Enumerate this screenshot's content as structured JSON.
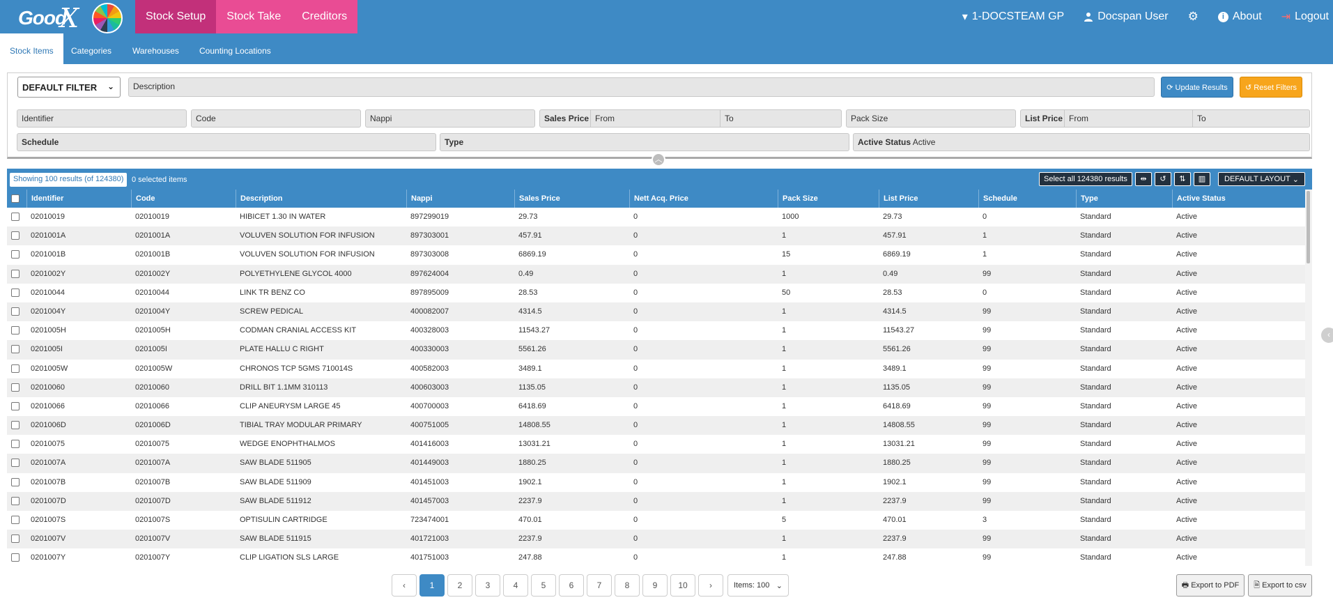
{
  "brand": {
    "logo_text": "Good",
    "logo_x": "X"
  },
  "main_nav": [
    {
      "label": "Stock Setup",
      "active": true
    },
    {
      "label": "Stock Take",
      "active": false
    },
    {
      "label": "Creditors",
      "active": false
    }
  ],
  "right_nav": {
    "practice": "1-DOCSTEAM GP",
    "user": "Docspan User",
    "about": "About",
    "logout": "Logout"
  },
  "sub_tabs": [
    {
      "label": "Stock Items",
      "active": true
    },
    {
      "label": "Categories",
      "active": false
    },
    {
      "label": "Warehouses",
      "active": false
    },
    {
      "label": "Counting Locations",
      "active": false
    }
  ],
  "filters": {
    "filter_select": "DEFAULT FILTER",
    "description_label": "Description",
    "identifier_label": "Identifier",
    "code_label": "Code",
    "nappi_label": "Nappi",
    "sales_price_label": "Sales Price",
    "sales_from": "From",
    "sales_to": "To",
    "pack_size_label": "Pack Size",
    "list_price_label": "List Price",
    "list_from": "From",
    "list_to": "To",
    "schedule_label": "Schedule",
    "type_label": "Type",
    "active_status_label": "Active Status",
    "active_status_value": "Active",
    "update_button": "Update Results",
    "reset_button": "Reset Filters"
  },
  "grid_toolbar": {
    "showing": "Showing 100 results (of 124380)",
    "selected": "0 selected items",
    "select_all": "Select all 124380 results",
    "layout": "DEFAULT LAYOUT"
  },
  "columns": [
    "Identifier",
    "Code",
    "Description",
    "Nappi",
    "Sales Price",
    "Nett Acq. Price",
    "Pack Size",
    "List Price",
    "Schedule",
    "Type",
    "Active Status"
  ],
  "rows": [
    [
      "02010019",
      "02010019",
      "HIBICET 1.30 IN WATER",
      "897299019",
      "29.73",
      "0",
      "1000",
      "29.73",
      "0",
      "Standard",
      "Active"
    ],
    [
      "0201001A",
      "0201001A",
      "VOLUVEN SOLUTION FOR INFUSION",
      "897303001",
      "457.91",
      "0",
      "1",
      "457.91",
      "1",
      "Standard",
      "Active"
    ],
    [
      "0201001B",
      "0201001B",
      "VOLUVEN SOLUTION FOR INFUSION",
      "897303008",
      "6869.19",
      "0",
      "15",
      "6869.19",
      "1",
      "Standard",
      "Active"
    ],
    [
      "0201002Y",
      "0201002Y",
      "POLYETHYLENE GLYCOL 4000",
      "897624004",
      "0.49",
      "0",
      "1",
      "0.49",
      "99",
      "Standard",
      "Active"
    ],
    [
      "02010044",
      "02010044",
      "LINK TR BENZ CO",
      "897895009",
      "28.53",
      "0",
      "50",
      "28.53",
      "0",
      "Standard",
      "Active"
    ],
    [
      "0201004Y",
      "0201004Y",
      "SCREW PEDICAL",
      "400082007",
      "4314.5",
      "0",
      "1",
      "4314.5",
      "99",
      "Standard",
      "Active"
    ],
    [
      "0201005H",
      "0201005H",
      "CODMAN CRANIAL ACCESS KIT",
      "400328003",
      "11543.27",
      "0",
      "1",
      "11543.27",
      "99",
      "Standard",
      "Active"
    ],
    [
      "0201005I",
      "0201005I",
      "PLATE HALLU C RIGHT",
      "400330003",
      "5561.26",
      "0",
      "1",
      "5561.26",
      "99",
      "Standard",
      "Active"
    ],
    [
      "0201005W",
      "0201005W",
      "CHRONOS TCP 5GMS 710014S",
      "400582003",
      "3489.1",
      "0",
      "1",
      "3489.1",
      "99",
      "Standard",
      "Active"
    ],
    [
      "02010060",
      "02010060",
      "DRILL BIT 1.1MM 310113",
      "400603003",
      "1135.05",
      "0",
      "1",
      "1135.05",
      "99",
      "Standard",
      "Active"
    ],
    [
      "02010066",
      "02010066",
      "CLIP ANEURYSM LARGE 45",
      "400700003",
      "6418.69",
      "0",
      "1",
      "6418.69",
      "99",
      "Standard",
      "Active"
    ],
    [
      "0201006D",
      "0201006D",
      "TIBIAL TRAY MODULAR PRIMARY",
      "400751005",
      "14808.55",
      "0",
      "1",
      "14808.55",
      "99",
      "Standard",
      "Active"
    ],
    [
      "02010075",
      "02010075",
      "WEDGE ENOPHTHALMOS",
      "401416003",
      "13031.21",
      "0",
      "1",
      "13031.21",
      "99",
      "Standard",
      "Active"
    ],
    [
      "0201007A",
      "0201007A",
      "SAW BLADE 511905",
      "401449003",
      "1880.25",
      "0",
      "1",
      "1880.25",
      "99",
      "Standard",
      "Active"
    ],
    [
      "0201007B",
      "0201007B",
      "SAW BLADE 511909",
      "401451003",
      "1902.1",
      "0",
      "1",
      "1902.1",
      "99",
      "Standard",
      "Active"
    ],
    [
      "0201007D",
      "0201007D",
      "SAW BLADE 511912",
      "401457003",
      "2237.9",
      "0",
      "1",
      "2237.9",
      "99",
      "Standard",
      "Active"
    ],
    [
      "0201007S",
      "0201007S",
      "OPTISULIN CARTRIDGE",
      "723474001",
      "470.01",
      "0",
      "5",
      "470.01",
      "3",
      "Standard",
      "Active"
    ],
    [
      "0201007V",
      "0201007V",
      "SAW BLADE 511915",
      "401721003",
      "2237.9",
      "0",
      "1",
      "2237.9",
      "99",
      "Standard",
      "Active"
    ],
    [
      "0201007Y",
      "0201007Y",
      "CLIP LIGATION SLS LARGE",
      "401751003",
      "247.88",
      "0",
      "1",
      "247.88",
      "99",
      "Standard",
      "Active"
    ]
  ],
  "pagination": {
    "prev": "‹",
    "next": "›",
    "pages": [
      "1",
      "2",
      "3",
      "4",
      "5",
      "6",
      "7",
      "8",
      "9",
      "10"
    ],
    "current": "1",
    "items": "Items: 100"
  },
  "export": {
    "pdf": "Export to PDF",
    "csv": "Export to csv"
  }
}
